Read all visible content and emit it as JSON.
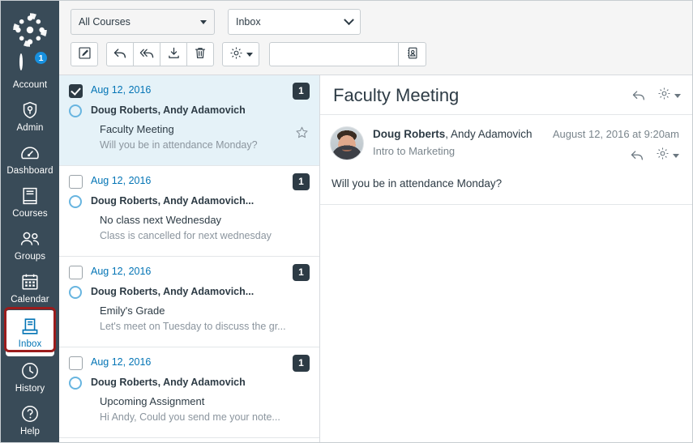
{
  "globalnav": {
    "logo": "canvas-logo",
    "items": [
      {
        "label": "Account",
        "icon": "account-avatar",
        "badge": "1"
      },
      {
        "label": "Admin",
        "icon": "shield-icon"
      },
      {
        "label": "Dashboard",
        "icon": "gauge-icon"
      },
      {
        "label": "Courses",
        "icon": "book-icon"
      },
      {
        "label": "Groups",
        "icon": "people-icon"
      },
      {
        "label": "Calendar",
        "icon": "calendar-icon"
      },
      {
        "label": "Inbox",
        "icon": "inbox-icon"
      },
      {
        "label": "History",
        "icon": "clock-icon"
      },
      {
        "label": "Help",
        "icon": "question-circle-icon"
      }
    ]
  },
  "toolbar": {
    "course_filter": "All Courses",
    "scope_filter": "Inbox",
    "search_value": "",
    "search_placeholder": "",
    "buttons": {
      "compose": "compose-icon",
      "reply": "reply-icon",
      "reply_all": "reply-all-icon",
      "archive": "archive-icon",
      "delete": "trash-icon",
      "settings": "gear-icon",
      "address_book": "address-book-icon"
    }
  },
  "conversations": [
    {
      "date": "Aug 12, 2016",
      "participants": "Doug Roberts, Andy Adamovich",
      "subject": "Faculty Meeting",
      "preview": "Will you be in attendance Monday?",
      "count": "1",
      "selected": true,
      "checked": true,
      "starred": false
    },
    {
      "date": "Aug 12, 2016",
      "participants": "Doug Roberts, Andy Adamovich...",
      "subject": "No class next Wednesday",
      "preview": "Class is cancelled for next wednesday",
      "count": "1",
      "selected": false,
      "checked": false,
      "starred": false
    },
    {
      "date": "Aug 12, 2016",
      "participants": "Doug Roberts, Andy Adamovich...",
      "subject": "Emily's Grade",
      "preview": "Let's meet on Tuesday to discuss the gr...",
      "count": "1",
      "selected": false,
      "checked": false,
      "starred": false
    },
    {
      "date": "Aug 12, 2016",
      "participants": "Doug Roberts, Andy Adamovich",
      "subject": "Upcoming Assignment",
      "preview": "Hi Andy, Could you send me your note...",
      "count": "1",
      "selected": false,
      "checked": false,
      "starred": false
    }
  ],
  "detail": {
    "title": "Faculty Meeting",
    "message": {
      "author_bold": "Doug Roberts",
      "author_rest": ", Andy Adamovich",
      "course": "Intro to Marketing",
      "timestamp": "August 12, 2016 at 9:20am",
      "body": "Will you be in attendance Monday?"
    }
  },
  "colors": {
    "nav_bg": "#394B58",
    "link_blue": "#0374B5",
    "selected_row": "#E5F2F8",
    "badge_dark": "#2D3B45",
    "highlight_red": "#9B1C1C",
    "account_badge_blue": "#1790DF"
  }
}
